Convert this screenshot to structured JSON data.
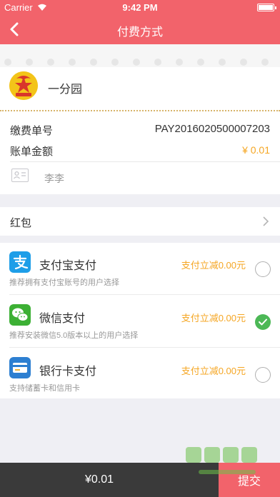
{
  "status_bar": {
    "carrier": "Carrier",
    "time": "9:42 PM"
  },
  "nav": {
    "title": "付费方式",
    "back_icon": "chevron-left-icon"
  },
  "bill": {
    "school_name": "一分园",
    "order_label": "缴费单号",
    "order_no": "PAY2016020500007203",
    "amount_label": "账单金额",
    "amount": "¥ 0.01",
    "payer": "李李"
  },
  "red_packet": {
    "label": "红包"
  },
  "payment_methods": [
    {
      "name": "支付宝支付",
      "desc": "推荐拥有支付宝账号的用户选择",
      "promo": "支付立减0.00元",
      "selected": false,
      "icon": "alipay-icon",
      "color": "#1e9ee8"
    },
    {
      "name": "微信支付",
      "desc": "推荐安装微信5.0版本以上的用户选择",
      "promo": "支付立减0.00元",
      "selected": true,
      "icon": "wechat-icon",
      "color": "#3cb034"
    },
    {
      "name": "银行卡支付",
      "desc": "支持储蓄卡和信用卡",
      "promo": "支付立减0.00元",
      "selected": false,
      "icon": "bank-card-icon",
      "color": "#2d7fd1"
    }
  ],
  "footer": {
    "total": "¥0.01",
    "submit_label": "提交"
  },
  "colors": {
    "brand": "#f2636b",
    "promo": "#f5a623",
    "checked": "#4cb856",
    "footer_dark": "#3a3a3a"
  }
}
